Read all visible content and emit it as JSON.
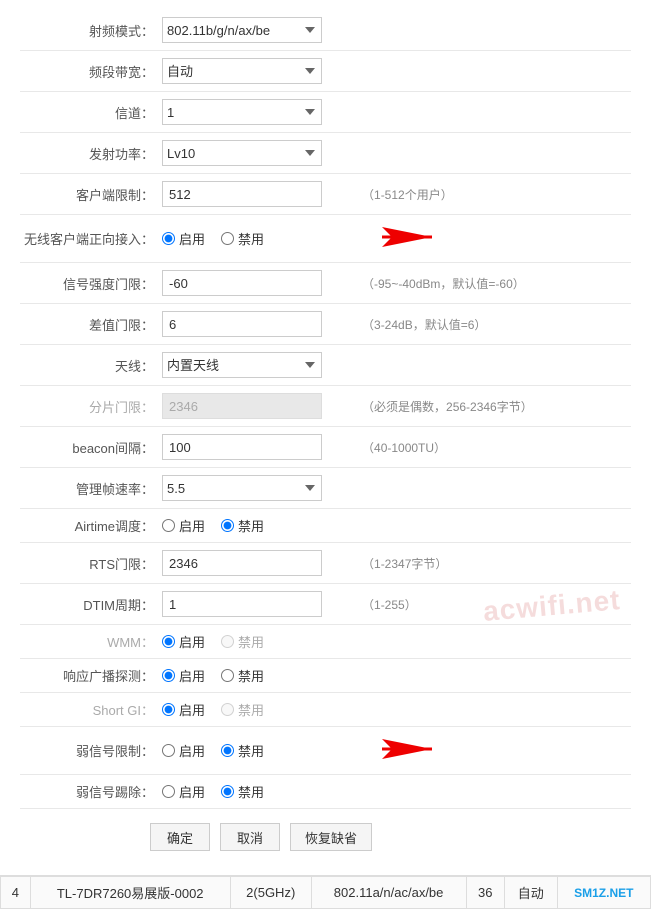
{
  "form": {
    "rows": [
      {
        "id": "rf-mode",
        "label": "射频模式：",
        "type": "select",
        "value": "802.11b/g/n/ax/be",
        "options": [
          "802.11b/g/n/ax/be"
        ],
        "hint": ""
      },
      {
        "id": "bandwidth",
        "label": "频段带宽：",
        "type": "select",
        "value": "自动",
        "options": [
          "自动"
        ],
        "hint": ""
      },
      {
        "id": "channel",
        "label": "信道：",
        "type": "select",
        "value": "1",
        "options": [
          "1"
        ],
        "hint": ""
      },
      {
        "id": "tx-power",
        "label": "发射功率：",
        "type": "select",
        "value": "Lv10",
        "options": [
          "Lv10"
        ],
        "hint": ""
      },
      {
        "id": "client-limit",
        "label": "客户端限制：",
        "type": "input",
        "value": "512",
        "hint": "（1-512个用户）"
      },
      {
        "id": "wireless-forward",
        "label": "无线客户端正向接入：",
        "type": "radio",
        "options": [
          {
            "value": "enable",
            "label": "启用",
            "checked": true
          },
          {
            "value": "disable",
            "label": "禁用",
            "checked": false
          }
        ],
        "hint": "",
        "hasArrow": true,
        "arrowDirection": "right"
      },
      {
        "id": "signal-threshold",
        "label": "信号强度门限：",
        "type": "input",
        "value": "-60",
        "hint": "（-95~-40dBm，默认值=-60）"
      },
      {
        "id": "diff-threshold",
        "label": "差值门限：",
        "type": "input",
        "value": "6",
        "hint": "（3-24dB，默认值=6）"
      },
      {
        "id": "antenna",
        "label": "天线：",
        "type": "select",
        "value": "内置天线",
        "options": [
          "内置天线"
        ],
        "hint": ""
      },
      {
        "id": "fragment",
        "label": "分片门限：",
        "type": "input",
        "value": "2346",
        "hint": "（必须是偶数，256-2346字节）",
        "disabled": true,
        "labelDisabled": true
      },
      {
        "id": "beacon",
        "label": "beacon间隔：",
        "type": "input",
        "value": "100",
        "hint": "（40-1000TU）"
      },
      {
        "id": "mgmt-rate",
        "label": "管理帧速率：",
        "type": "select",
        "value": "5.5",
        "options": [
          "5.5"
        ],
        "hint": ""
      },
      {
        "id": "airtime",
        "label": "Airtime调度：",
        "type": "radio",
        "options": [
          {
            "value": "enable",
            "label": "启用",
            "checked": false
          },
          {
            "value": "disable",
            "label": "禁用",
            "checked": true
          }
        ],
        "hint": ""
      },
      {
        "id": "rts",
        "label": "RTS门限：",
        "type": "input",
        "value": "2346",
        "hint": "（1-2347字节）"
      },
      {
        "id": "dtim",
        "label": "DTIM周期：",
        "type": "input",
        "value": "1",
        "hint": "（1-255）"
      },
      {
        "id": "wmm",
        "label": "WMM：",
        "type": "radio",
        "options": [
          {
            "value": "enable",
            "label": "启用",
            "checked": true
          },
          {
            "value": "disable",
            "label": "禁用",
            "checked": false,
            "disabled": true
          }
        ],
        "hint": "",
        "labelDisabled": true
      },
      {
        "id": "multicast-probe",
        "label": "响应广播探测：",
        "type": "radio",
        "options": [
          {
            "value": "enable",
            "label": "启用",
            "checked": true
          },
          {
            "value": "disable",
            "label": "禁用",
            "checked": false
          }
        ],
        "hint": ""
      },
      {
        "id": "short-gi",
        "label": "Short GI：",
        "type": "radio",
        "options": [
          {
            "value": "enable",
            "label": "启用",
            "checked": true
          },
          {
            "value": "disable",
            "label": "禁用",
            "checked": false,
            "disabled": true
          }
        ],
        "hint": "",
        "labelDisabled": true
      },
      {
        "id": "weak-signal-limit",
        "label": "弱信号限制：",
        "type": "radio",
        "options": [
          {
            "value": "enable",
            "label": "启用",
            "checked": false
          },
          {
            "value": "disable",
            "label": "禁用",
            "checked": true
          }
        ],
        "hint": "",
        "hasArrow": true,
        "arrowDirection": "left"
      },
      {
        "id": "weak-signal-kick",
        "label": "弱信号踢除：",
        "type": "radio",
        "options": [
          {
            "value": "enable",
            "label": "启用",
            "checked": false
          },
          {
            "value": "disable",
            "label": "禁用",
            "checked": true
          }
        ],
        "hint": ""
      }
    ],
    "buttons": {
      "confirm": "确定",
      "cancel": "取消",
      "restore": "恢复缺省"
    }
  },
  "footer": {
    "columns": [
      "4",
      "TL-7DR7260易展版-0002",
      "2(5GHz)",
      "802.11a/n/ac/ax/be",
      "36",
      "自动"
    ],
    "smtz": "SM1Z.NET"
  },
  "watermark": "acwifi.net"
}
